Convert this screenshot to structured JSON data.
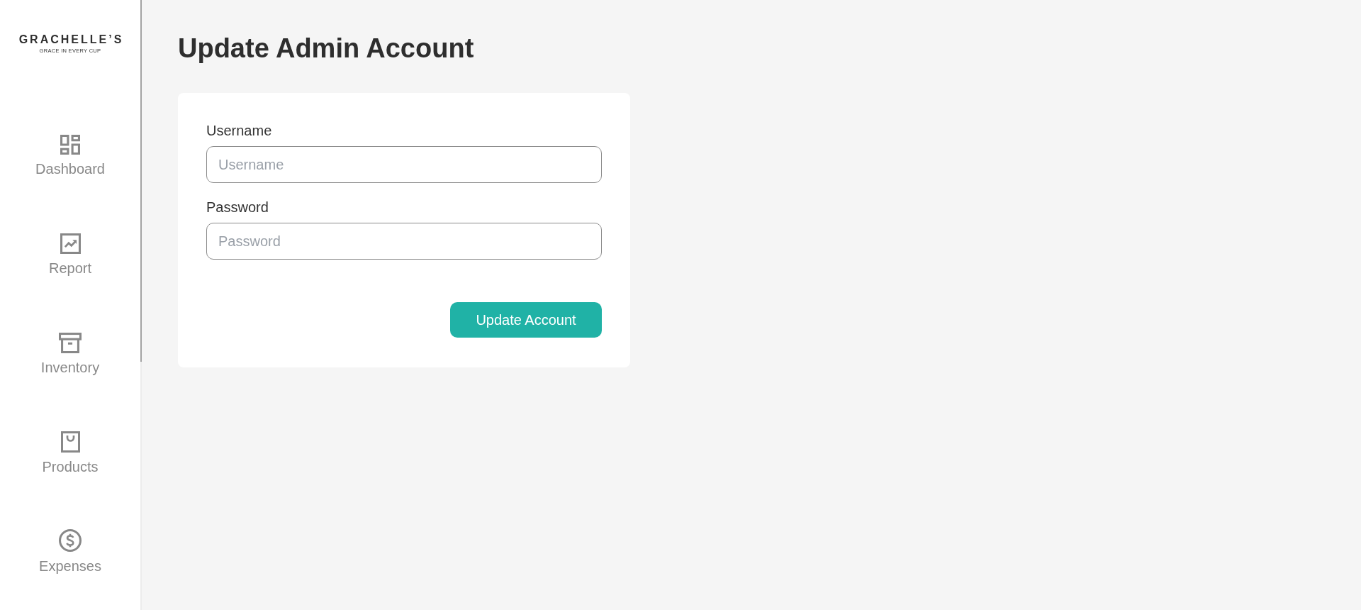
{
  "sidebar": {
    "logo": {
      "name": "GRACHELLE’S",
      "tagline": "GRACE IN EVERY CUP"
    },
    "items": [
      {
        "label": "Dashboard",
        "kind": "dashboard",
        "selected": false
      },
      {
        "label": "Report",
        "kind": "report",
        "selected": false
      },
      {
        "label": "Inventory",
        "kind": "inventory",
        "selected": false
      },
      {
        "label": "Products",
        "kind": "products",
        "selected": false
      },
      {
        "label": "Expenses",
        "kind": "expenses",
        "selected": false
      }
    ]
  },
  "page": {
    "title": "Update Admin Account"
  },
  "form": {
    "fields": [
      {
        "label": "Username",
        "placeholder": "Username"
      },
      {
        "label": "Password",
        "placeholder": "Password"
      }
    ],
    "submit": "Update Account"
  }
}
